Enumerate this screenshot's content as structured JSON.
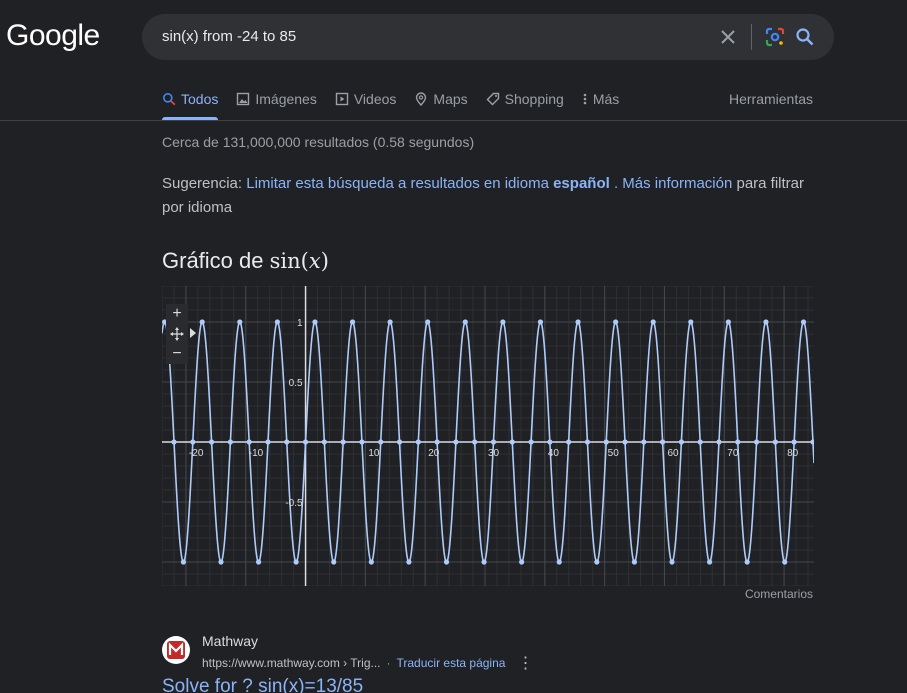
{
  "logo": "Google",
  "search": {
    "query": "sin(x) from -24 to 85"
  },
  "tabs": [
    {
      "label": "Todos",
      "icon": "search-icon",
      "active": true
    },
    {
      "label": "Imágenes",
      "icon": "image-icon"
    },
    {
      "label": "Videos",
      "icon": "play-icon"
    },
    {
      "label": "Maps",
      "icon": "map-pin-icon"
    },
    {
      "label": "Shopping",
      "icon": "tag-icon"
    },
    {
      "label": "Más",
      "icon": "more-vert-icon"
    }
  ],
  "tools_label": "Herramientas",
  "stats": "Cerca de 131,000,000 resultados (0.58 segundos)",
  "suggestion": {
    "prefix": "Sugerencia:",
    "link_text": "Limitar esta búsqueda a resultados en idioma",
    "link_bold": "español",
    "more_link": ". Más información",
    "suffix": " para filtrar por idioma"
  },
  "graph_title": {
    "prefix": "Gráfico de",
    "fn": "sin",
    "var": "x"
  },
  "zoom": {
    "plus": "+",
    "minus": "−"
  },
  "chart_data": {
    "type": "line",
    "function": "sin(x)",
    "xlim": [
      -24,
      85
    ],
    "ylim": [
      -1.2,
      1.3
    ],
    "x_ticks": [
      -20,
      -10,
      10,
      20,
      30,
      40,
      50,
      60,
      70,
      80
    ],
    "y_ticks": [
      1,
      0.5,
      -0.5
    ],
    "grid": true,
    "line_color": "#aecbfa",
    "axis_color": "#dadce0"
  },
  "feedback": "Comentarios",
  "result": {
    "site": "Mathway",
    "url": "https://www.mathway.com › Trig...",
    "translate": "Traducir esta página",
    "title": "Solve for ? sin(x)=13/85"
  }
}
